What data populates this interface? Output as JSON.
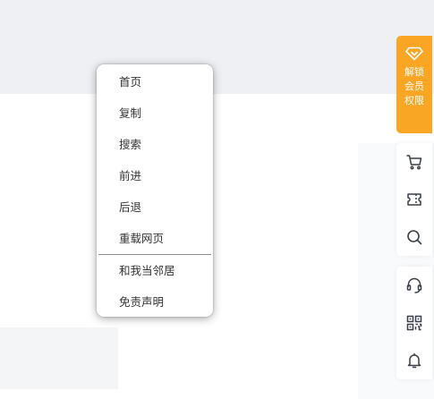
{
  "context_menu": {
    "items": [
      {
        "label": "首页"
      },
      {
        "label": "复制"
      },
      {
        "label": "搜索"
      },
      {
        "label": "前进"
      },
      {
        "label": "后退"
      },
      {
        "label": "重载网页"
      }
    ],
    "extra_items": [
      {
        "label": "和我当邻居"
      },
      {
        "label": "免责声明"
      }
    ]
  },
  "sidebar": {
    "unlock": {
      "label": "解锁会员权限",
      "icon": "diamond-icon",
      "color": "#f8a623"
    },
    "tools_top": [
      {
        "icon": "cart-icon"
      },
      {
        "icon": "ticket-icon"
      },
      {
        "icon": "search-icon"
      }
    ],
    "tools_bottom": [
      {
        "icon": "headset-icon"
      },
      {
        "icon": "qr-code-icon"
      },
      {
        "icon": "bell-icon"
      }
    ]
  }
}
